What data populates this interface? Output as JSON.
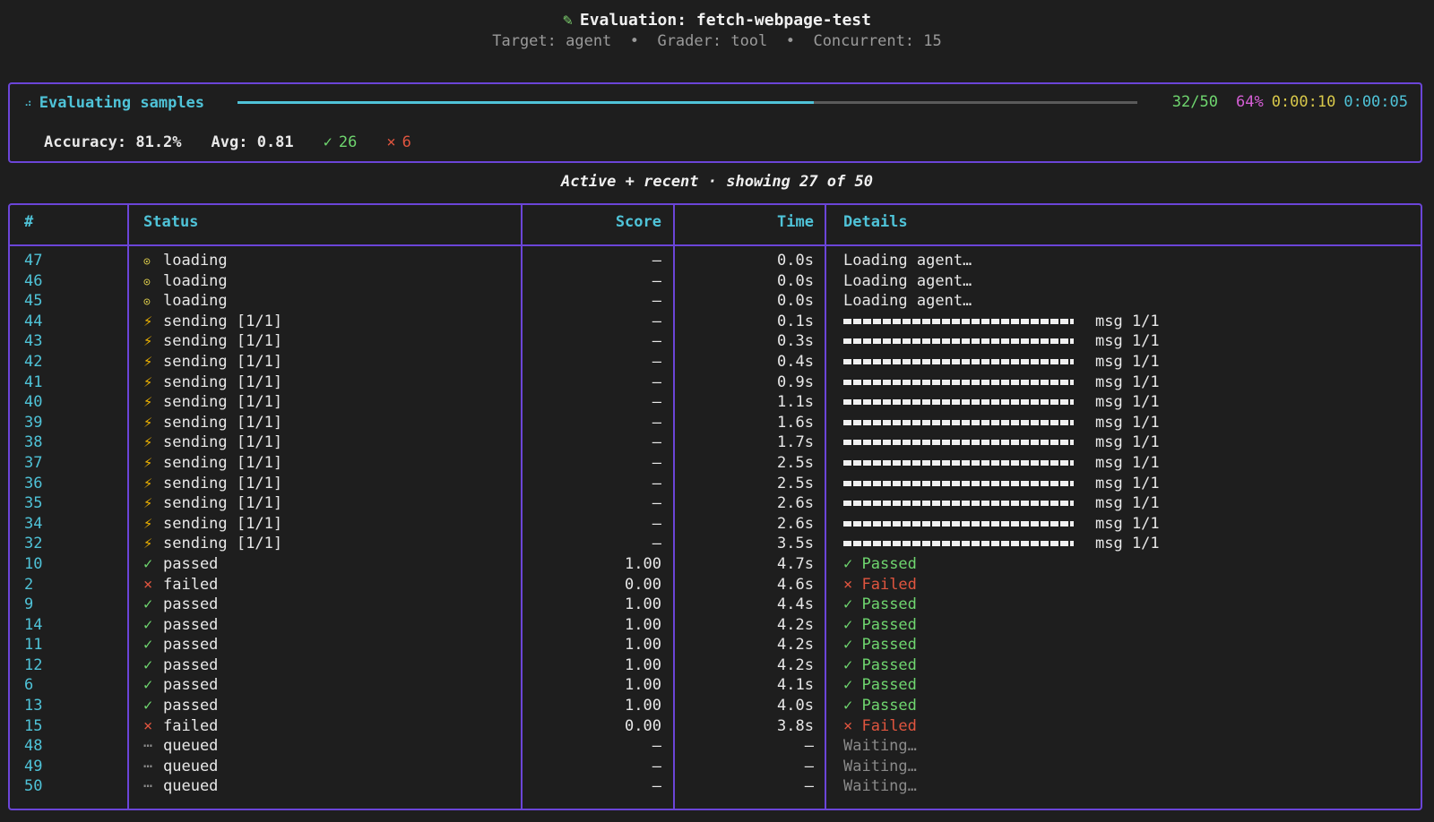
{
  "header": {
    "icon": "pencil-icon",
    "title": "Evaluation: fetch-webpage-test",
    "subtitle": "Target: agent  •  Grader: tool  •  Concurrent: 15"
  },
  "progress": {
    "label": "Evaluating samples",
    "fraction": 0.64,
    "count": "32/50",
    "percent": "64%",
    "elapsed": "0:00:10",
    "remaining": "0:00:05",
    "accuracy": "Accuracy: 81.2%",
    "avg": "Avg: 0.81",
    "passed_count": "26",
    "failed_count": "6"
  },
  "caption": "Active + recent · showing 27 of 50",
  "table": {
    "headers": {
      "num": "#",
      "status": "Status",
      "score": "Score",
      "time": "Time",
      "details": "Details"
    },
    "rows": [
      {
        "num": "47",
        "kind": "loading",
        "status": "loading",
        "score": "–",
        "time": "0.0s",
        "details": "Loading agent…"
      },
      {
        "num": "46",
        "kind": "loading",
        "status": "loading",
        "score": "–",
        "time": "0.0s",
        "details": "Loading agent…"
      },
      {
        "num": "45",
        "kind": "loading",
        "status": "loading",
        "score": "–",
        "time": "0.0s",
        "details": "Loading agent…"
      },
      {
        "num": "44",
        "kind": "sending",
        "status": "sending [1/1]",
        "score": "–",
        "time": "0.1s",
        "details": "msg 1/1"
      },
      {
        "num": "43",
        "kind": "sending",
        "status": "sending [1/1]",
        "score": "–",
        "time": "0.3s",
        "details": "msg 1/1"
      },
      {
        "num": "42",
        "kind": "sending",
        "status": "sending [1/1]",
        "score": "–",
        "time": "0.4s",
        "details": "msg 1/1"
      },
      {
        "num": "41",
        "kind": "sending",
        "status": "sending [1/1]",
        "score": "–",
        "time": "0.9s",
        "details": "msg 1/1"
      },
      {
        "num": "40",
        "kind": "sending",
        "status": "sending [1/1]",
        "score": "–",
        "time": "1.1s",
        "details": "msg 1/1"
      },
      {
        "num": "39",
        "kind": "sending",
        "status": "sending [1/1]",
        "score": "–",
        "time": "1.6s",
        "details": "msg 1/1"
      },
      {
        "num": "38",
        "kind": "sending",
        "status": "sending [1/1]",
        "score": "–",
        "time": "1.7s",
        "details": "msg 1/1"
      },
      {
        "num": "37",
        "kind": "sending",
        "status": "sending [1/1]",
        "score": "–",
        "time": "2.5s",
        "details": "msg 1/1"
      },
      {
        "num": "36",
        "kind": "sending",
        "status": "sending [1/1]",
        "score": "–",
        "time": "2.5s",
        "details": "msg 1/1"
      },
      {
        "num": "35",
        "kind": "sending",
        "status": "sending [1/1]",
        "score": "–",
        "time": "2.6s",
        "details": "msg 1/1"
      },
      {
        "num": "34",
        "kind": "sending",
        "status": "sending [1/1]",
        "score": "–",
        "time": "2.6s",
        "details": "msg 1/1"
      },
      {
        "num": "32",
        "kind": "sending",
        "status": "sending [1/1]",
        "score": "–",
        "time": "3.5s",
        "details": "msg 1/1"
      },
      {
        "num": "10",
        "kind": "passed",
        "status": "passed",
        "score": "1.00",
        "time": "4.7s",
        "details": "Passed"
      },
      {
        "num": "2",
        "kind": "failed",
        "status": "failed",
        "score": "0.00",
        "time": "4.6s",
        "details": "Failed"
      },
      {
        "num": "9",
        "kind": "passed",
        "status": "passed",
        "score": "1.00",
        "time": "4.4s",
        "details": "Passed"
      },
      {
        "num": "14",
        "kind": "passed",
        "status": "passed",
        "score": "1.00",
        "time": "4.2s",
        "details": "Passed"
      },
      {
        "num": "11",
        "kind": "passed",
        "status": "passed",
        "score": "1.00",
        "time": "4.2s",
        "details": "Passed"
      },
      {
        "num": "12",
        "kind": "passed",
        "status": "passed",
        "score": "1.00",
        "time": "4.2s",
        "details": "Passed"
      },
      {
        "num": "6",
        "kind": "passed",
        "status": "passed",
        "score": "1.00",
        "time": "4.1s",
        "details": "Passed"
      },
      {
        "num": "13",
        "kind": "passed",
        "status": "passed",
        "score": "1.00",
        "time": "4.0s",
        "details": "Passed"
      },
      {
        "num": "15",
        "kind": "failed",
        "status": "failed",
        "score": "0.00",
        "time": "3.8s",
        "details": "Failed"
      },
      {
        "num": "48",
        "kind": "queued",
        "status": "queued",
        "score": "–",
        "time": "–",
        "details": "Waiting…"
      },
      {
        "num": "49",
        "kind": "queued",
        "status": "queued",
        "score": "–",
        "time": "–",
        "details": "Waiting…"
      },
      {
        "num": "50",
        "kind": "queued",
        "status": "queued",
        "score": "–",
        "time": "–",
        "details": "Waiting…"
      }
    ]
  },
  "icons": {
    "loading": "loading-icon",
    "sending": "lightning-icon",
    "passed": "check-icon",
    "failed": "cross-icon",
    "queued": "ellipsis-icon"
  },
  "colors": {
    "border": "#6b45d8",
    "accent": "#4fc3d8",
    "pass": "#6fd66f",
    "fail": "#e0553f",
    "percent": "#d45ed4",
    "elapsed": "#d8c84a"
  }
}
